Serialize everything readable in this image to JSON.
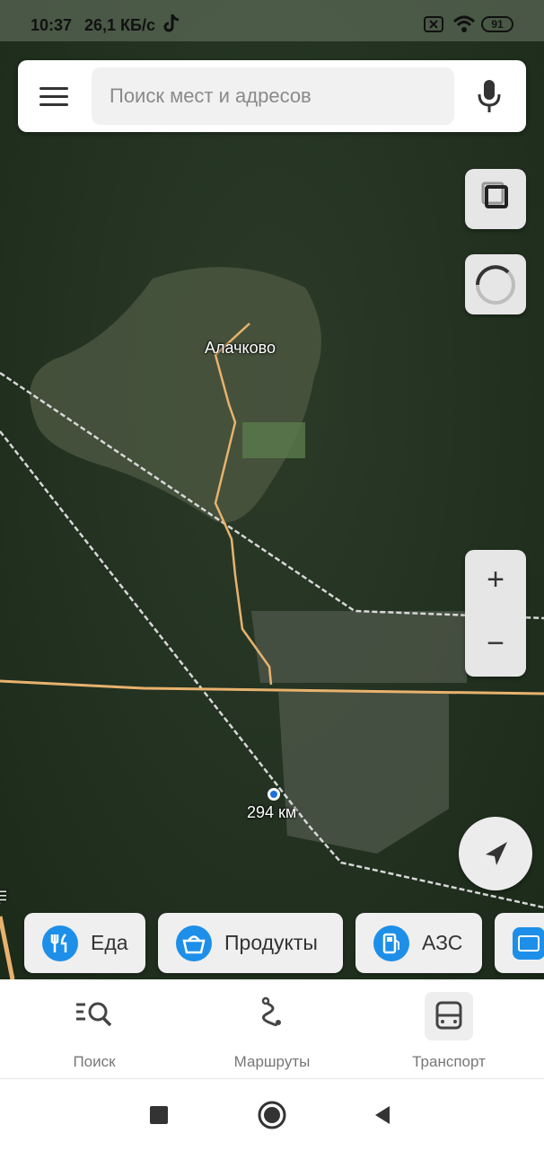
{
  "status_bar": {
    "time": "10:37",
    "speed": "26,1 КБ/с",
    "battery": "91",
    "icons": [
      "tiktok-icon",
      "sim-disabled-icon",
      "wifi-icon",
      "battery-icon"
    ]
  },
  "search": {
    "placeholder": "Поиск мест и адресов",
    "menu_icon": "hamburger-menu-icon",
    "mic_icon": "microphone-icon"
  },
  "map": {
    "place_label": "Алачково",
    "marker_label": "294 км",
    "road_label_partial": "ш.",
    "controls": {
      "layers_icon": "layers-icon",
      "speed_icon": "speedometer-icon",
      "zoom_in": "+",
      "zoom_out": "−",
      "locate_icon": "navigation-arrow-icon"
    }
  },
  "categories": [
    {
      "label": "Еда",
      "icon": "fork-knife-icon"
    },
    {
      "label": "Продукты",
      "icon": "basket-icon"
    },
    {
      "label": "АЗС",
      "icon": "fuel-pump-icon"
    },
    {
      "label": "",
      "icon": "parking-icon"
    }
  ],
  "bottom_tabs": [
    {
      "label": "Поиск",
      "icon": "search-list-icon"
    },
    {
      "label": "Маршруты",
      "icon": "route-icon"
    },
    {
      "label": "Транспорт",
      "icon": "bus-icon"
    }
  ],
  "nav_bar": {
    "icons": [
      "recents-square-icon",
      "home-circle-icon",
      "back-triangle-icon"
    ]
  },
  "colors": {
    "accent_blue": "#1d8fe9",
    "road_orange": "#e8b26e",
    "forest": "#243322"
  }
}
